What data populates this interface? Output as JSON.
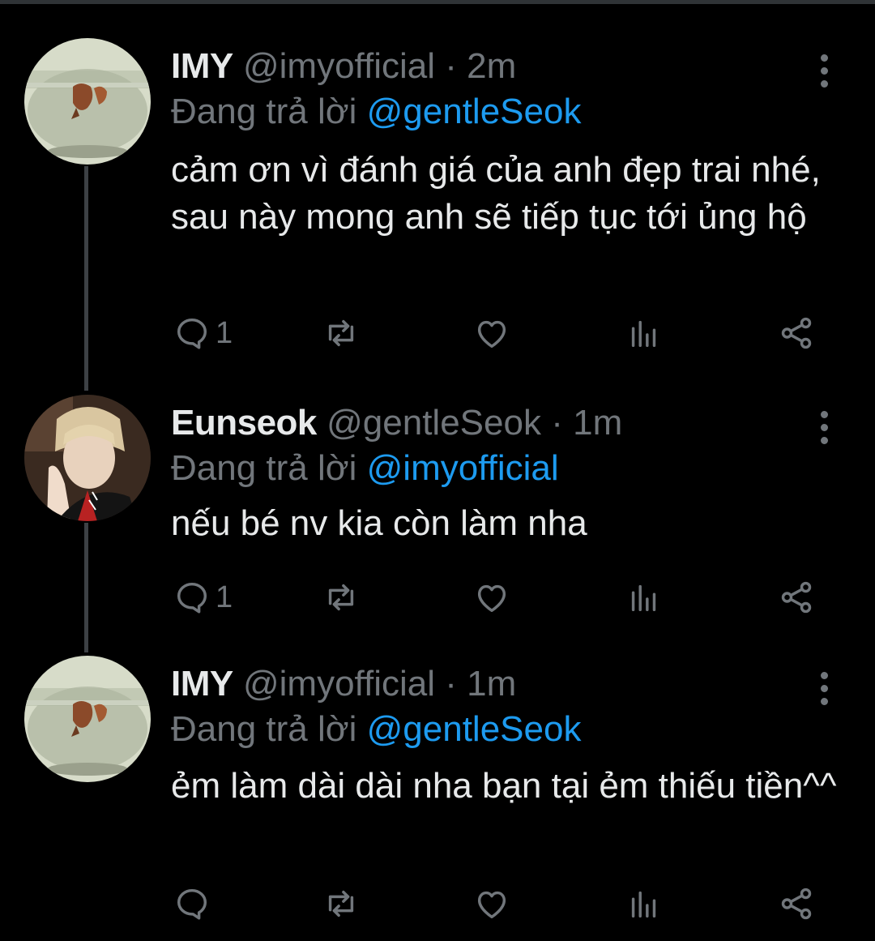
{
  "tweets": [
    {
      "name": "IMY",
      "handle": "@imyofficial",
      "separator": "·",
      "time": "2m",
      "reply_prefix": "Đang trả lời",
      "reply_to": "@gentleSeok",
      "text": "cảm ơn vì đánh giá của anh đẹp trai nhé, sau này mong anh sẽ tiếp tục tới ủng hộ",
      "reply_count": "1",
      "avatar": "fishbowl-avatar"
    },
    {
      "name": "Eunseok",
      "handle": "@gentleSeok",
      "separator": "·",
      "time": "1m",
      "reply_prefix": "Đang trả lời",
      "reply_to": "@imyofficial",
      "text": "nếu bé nv kia còn làm nha",
      "reply_count": "1",
      "avatar": "person-avatar"
    },
    {
      "name": "IMY",
      "handle": "@imyofficial",
      "separator": "·",
      "time": "1m",
      "reply_prefix": "Đang trả lời",
      "reply_to": "@gentleSeok",
      "text": "ẻm làm dài dài nha bạn tại ẻm thiếu tiền^^",
      "reply_count": "",
      "avatar": "fishbowl-avatar"
    }
  ],
  "icons": [
    "reply-icon",
    "retweet-icon",
    "like-icon",
    "views-icon",
    "share-icon",
    "more-options-icon"
  ],
  "colors": {
    "background": "#000000",
    "primary_text": "#e7e9ea",
    "secondary_text": "#71767b",
    "accent": "#1d9bf0"
  }
}
